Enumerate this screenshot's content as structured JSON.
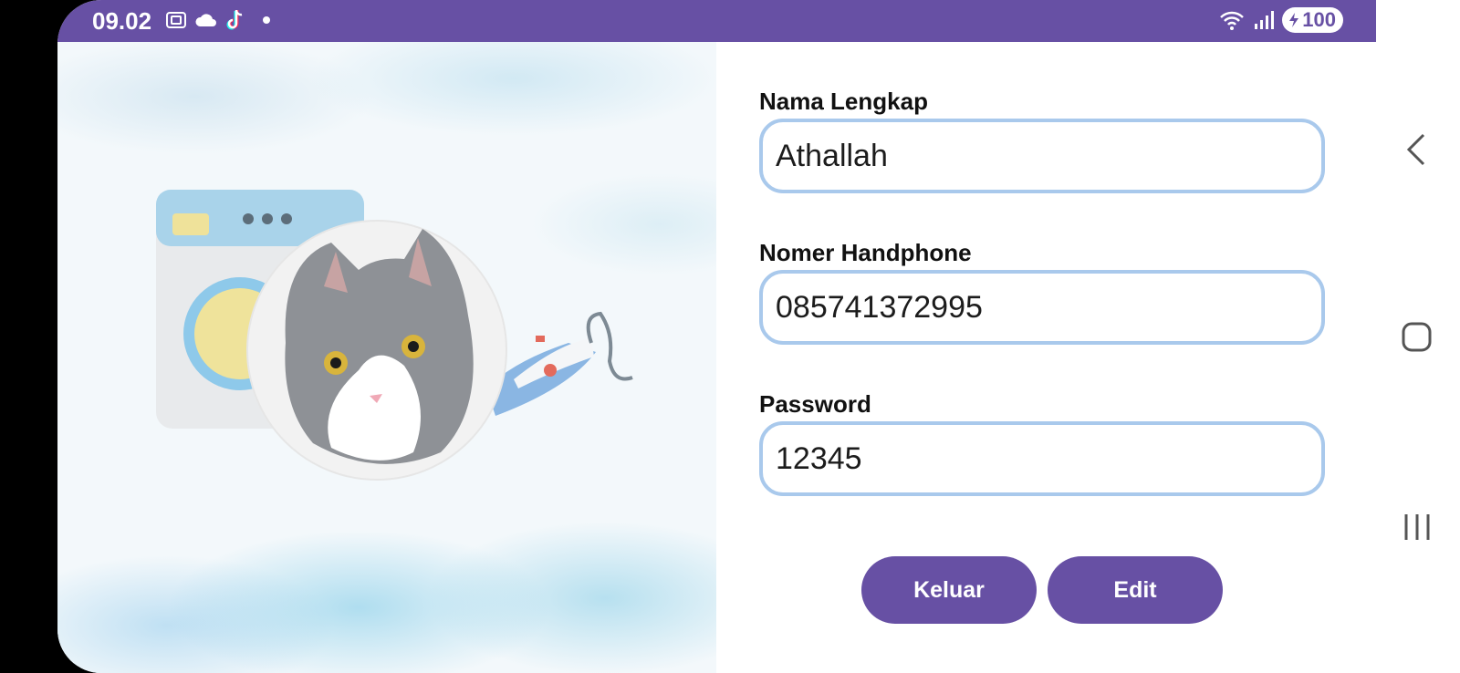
{
  "status_bar": {
    "time": "09.02",
    "battery": "100",
    "left_icons": [
      "screenshot-icon",
      "cloud-icon",
      "tiktok-icon",
      "notification-dot-icon"
    ],
    "right_icons": [
      "wifi-icon",
      "signal-icon",
      "battery-icon"
    ],
    "color": "#6750a4"
  },
  "form": {
    "name_label": "Nama Lengkap",
    "name_value": "Athallah",
    "phone_label": "Nomer Handphone",
    "phone_value": "085741372995",
    "password_label": "Password",
    "password_value": "12345"
  },
  "buttons": {
    "logout": "Keluar",
    "edit": "Edit"
  },
  "nav": {
    "icons": [
      "back-icon",
      "home-icon",
      "recent-apps-icon"
    ]
  },
  "colors": {
    "accent": "#6750a4",
    "field_border": "#a9c9ec"
  }
}
